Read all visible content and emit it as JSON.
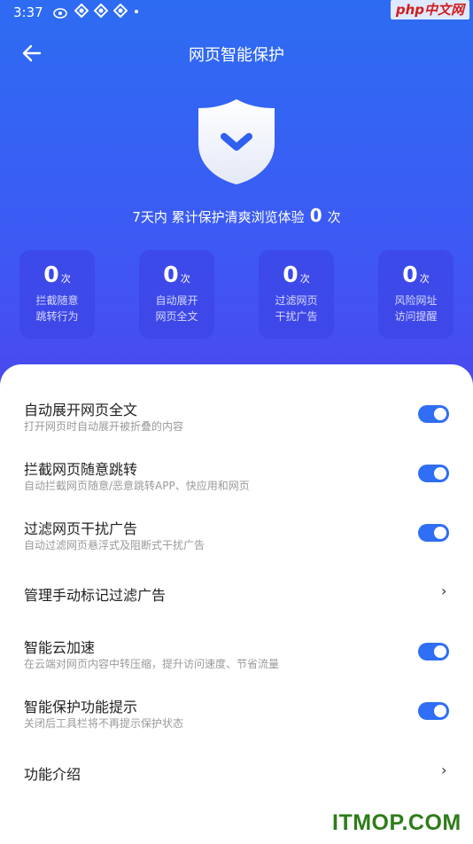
{
  "status_bar": {
    "time": "3:37",
    "icons": [
      "weibo-icon",
      "app-icon",
      "app-icon",
      "app-icon",
      "dot-icon"
    ],
    "watermark": "php中文网"
  },
  "header": {
    "back_icon": "arrow-left-icon",
    "title": "网页智能保护"
  },
  "summary": {
    "prefix": "7天内 累计保护清爽浏览体验",
    "count": "0",
    "suffix": "次"
  },
  "stats": [
    {
      "value": "0",
      "unit": "次",
      "line1": "拦截随意",
      "line2": "跳转行为"
    },
    {
      "value": "0",
      "unit": "次",
      "line1": "自动展开",
      "line2": "网页全文"
    },
    {
      "value": "0",
      "unit": "次",
      "line1": "过滤网页",
      "line2": "干扰广告"
    },
    {
      "value": "0",
      "unit": "次",
      "line1": "风险网址",
      "line2": "访问提醒"
    }
  ],
  "settings": [
    {
      "title": "自动展开网页全文",
      "subtitle": "打开网页时自动展开被折叠的内容",
      "control": "toggle",
      "on": true
    },
    {
      "title": "拦截网页随意跳转",
      "subtitle": "自动拦截网页随意/恶意跳转APP、快应用和网页",
      "control": "toggle",
      "on": true
    },
    {
      "title": "过滤网页干扰广告",
      "subtitle": "自动过滤网页悬浮式及阻断式干扰广告",
      "control": "toggle",
      "on": true
    },
    {
      "title": "管理手动标记过滤广告",
      "subtitle": "",
      "control": "chevron",
      "chevron": "›"
    },
    {
      "title": "智能云加速",
      "subtitle": "在云端对网页内容中转压缩，提升访问速度、节省流量",
      "control": "toggle",
      "on": true
    },
    {
      "title": "智能保护功能提示",
      "subtitle": "关闭后工具栏将不再提示保护状态",
      "control": "toggle",
      "on": true
    },
    {
      "title": "功能介绍",
      "subtitle": "",
      "control": "chevron",
      "chevron": "›"
    }
  ],
  "colors": {
    "accent": "#2f6ef5",
    "hero_top": "#2d6cf2",
    "hero_bottom": "#4a49ee"
  },
  "watermark_bottom": "ITMOP.COM"
}
